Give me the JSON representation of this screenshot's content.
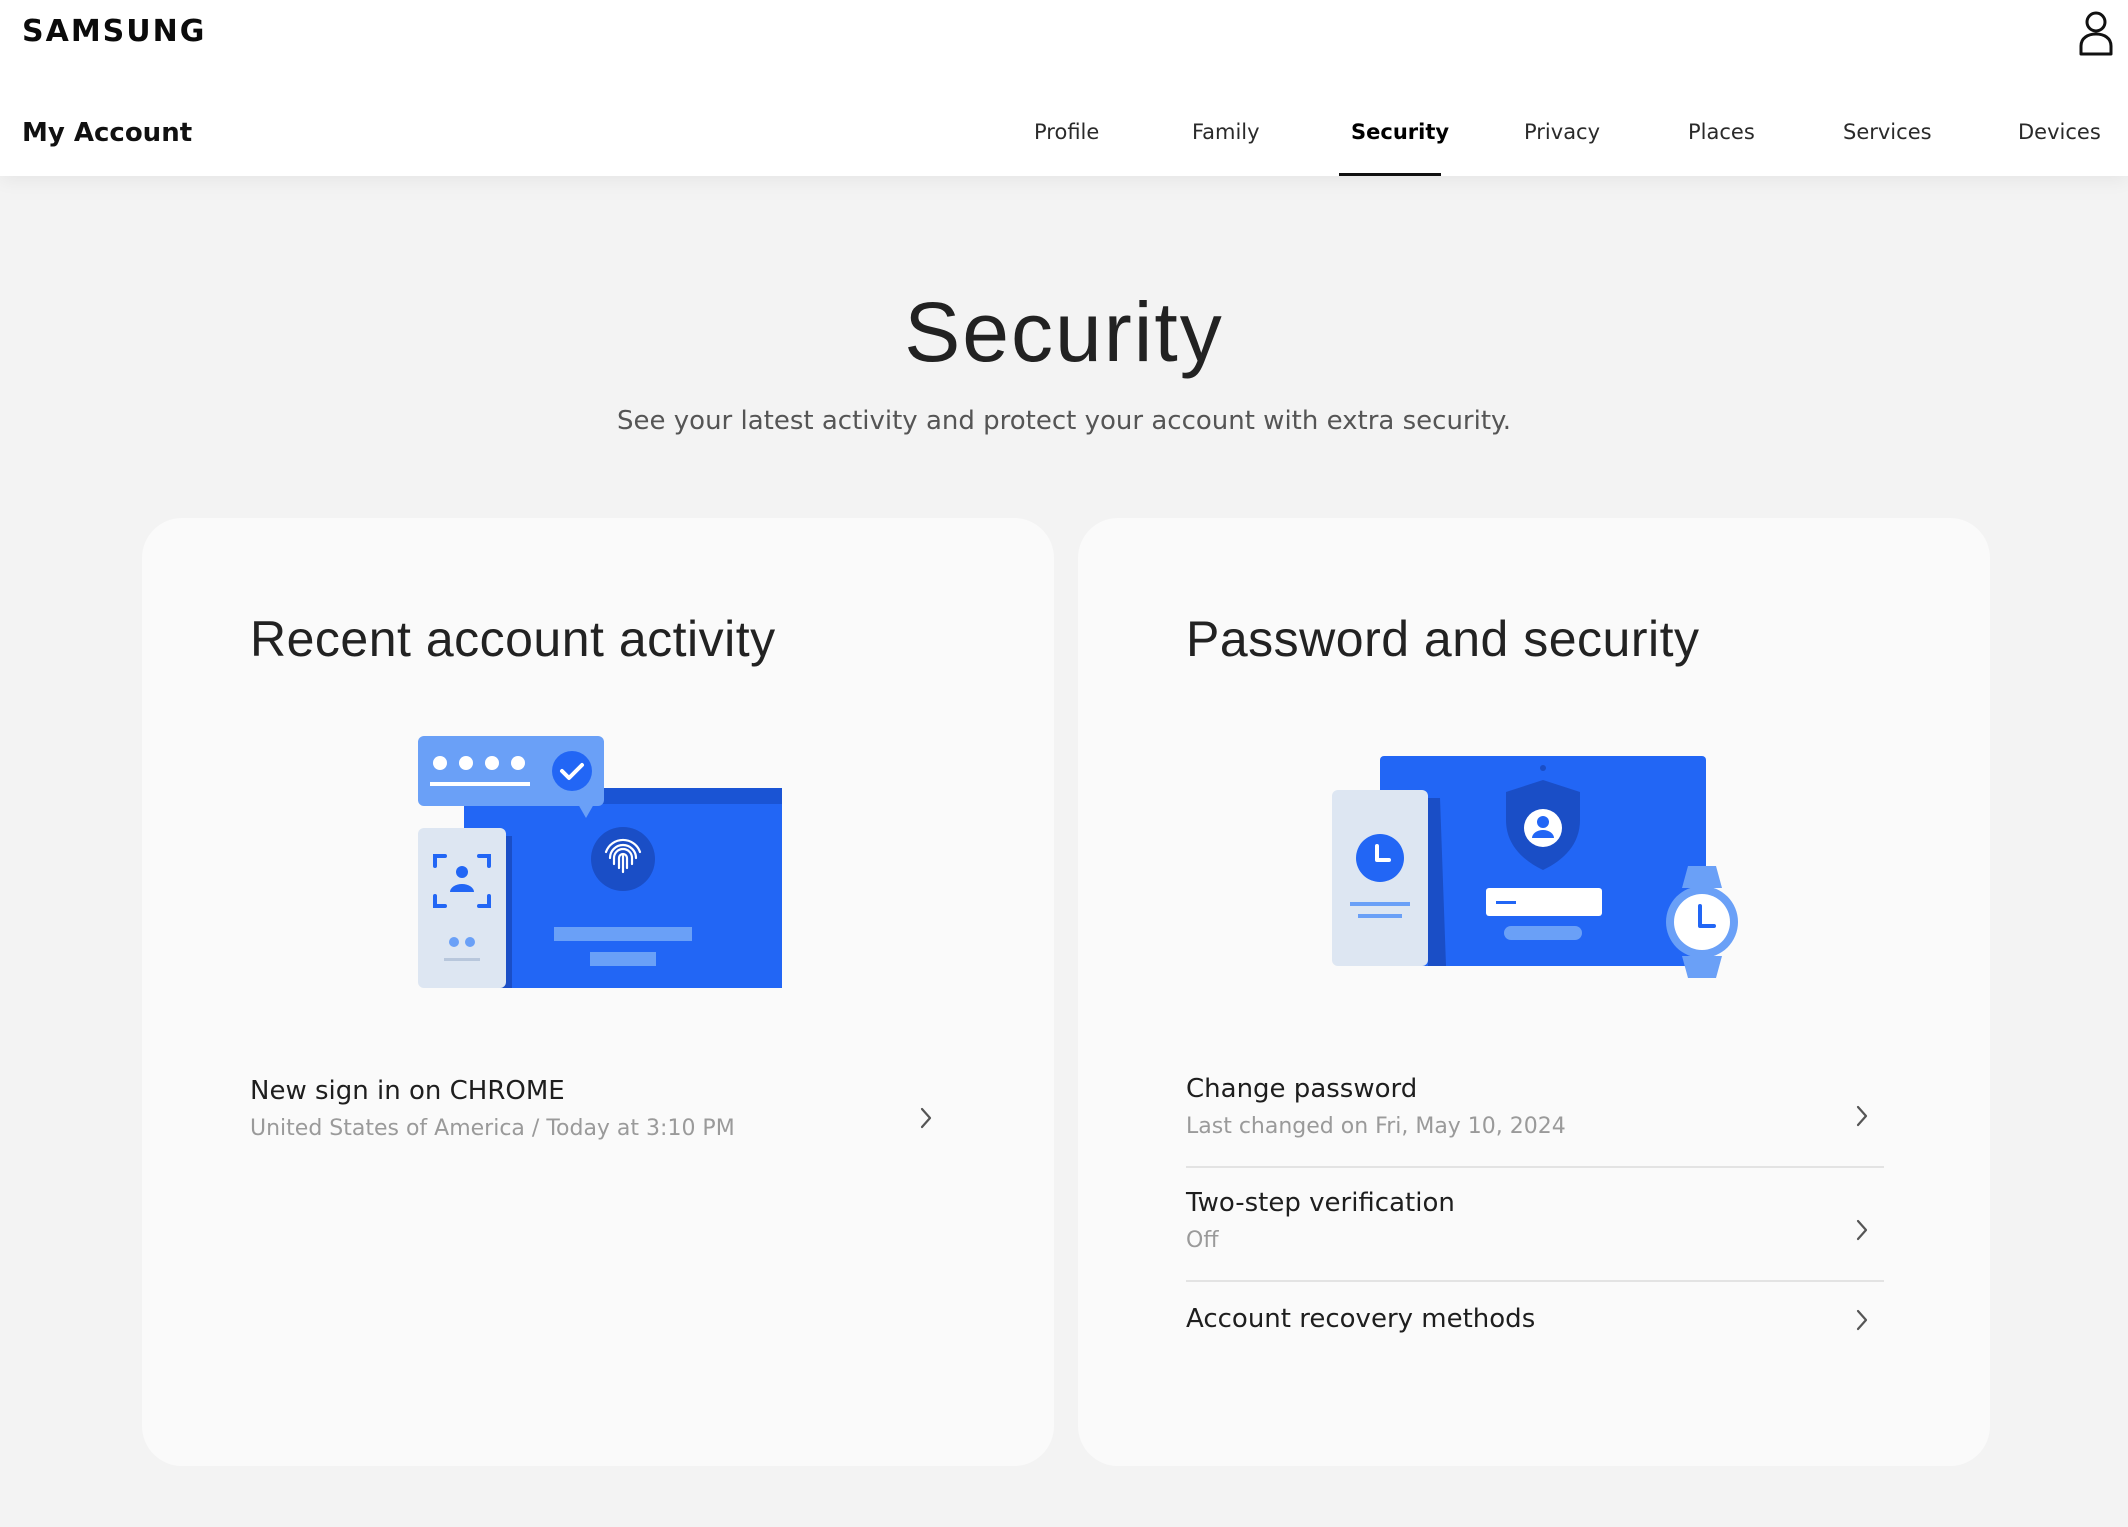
{
  "header": {
    "brand": "SAMSUNG",
    "app_title": "My Account",
    "user_icon": "person-icon",
    "tabs": [
      {
        "label": "Profile",
        "active": false
      },
      {
        "label": "Family",
        "active": false
      },
      {
        "label": "Security",
        "active": true
      },
      {
        "label": "Privacy",
        "active": false
      },
      {
        "label": "Places",
        "active": false
      },
      {
        "label": "Services",
        "active": false
      },
      {
        "label": "Devices",
        "active": false
      }
    ]
  },
  "main": {
    "title": "Security",
    "subtitle": "See your latest activity and protect your account with extra security."
  },
  "recent_activity": {
    "title": "Recent account activity",
    "illustration": "sign-in-activity-illustration",
    "items": [
      {
        "primary": "New sign in on CHROME",
        "secondary": "United States of America / Today at 3:10 PM"
      }
    ]
  },
  "password_security": {
    "title": "Password and security",
    "illustration": "password-security-illustration",
    "items": [
      {
        "primary": "Change password",
        "secondary": "Last changed on Fri, May 10, 2024"
      },
      {
        "primary": "Two-step verification",
        "secondary": "Off"
      },
      {
        "primary": "Account recovery methods",
        "secondary": ""
      }
    ]
  },
  "colors": {
    "accent_blue": "#2266f5",
    "light_blue": "#6aa0f7",
    "pale_blue": "#dde6f2",
    "page_bg": "#f3f3f3",
    "card_bg": "#fafafa"
  }
}
